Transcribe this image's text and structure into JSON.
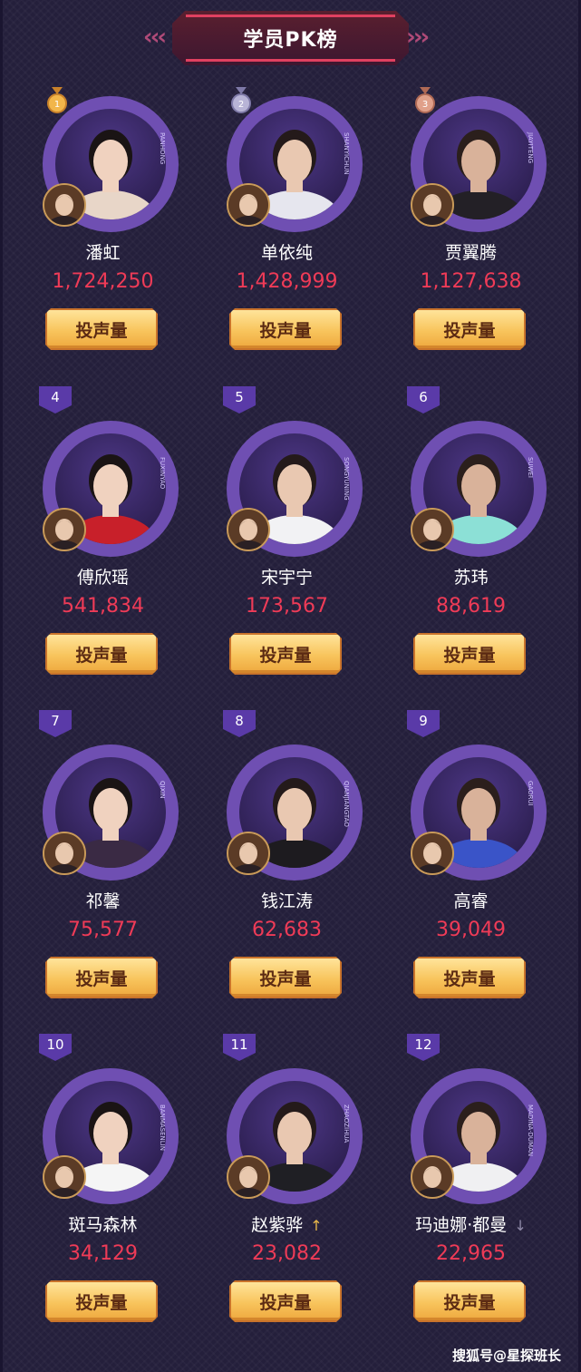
{
  "header": {
    "title": "学员PK榜",
    "left_decor": "‹‹‹",
    "right_decor": "›››"
  },
  "vote_button_label": "投声量",
  "students": [
    {
      "rank": "1",
      "name": "潘虹",
      "votes": "1,724,250",
      "ring_text": "PANHONG",
      "medal": "gold"
    },
    {
      "rank": "2",
      "name": "单依纯",
      "votes": "1,428,999",
      "ring_text": "SHANYICHUN",
      "medal": "silver"
    },
    {
      "rank": "3",
      "name": "贾翼腾",
      "votes": "1,127,638",
      "ring_text": "JIAYITENG",
      "medal": "bronze"
    },
    {
      "rank": "4",
      "name": "傅欣瑶",
      "votes": "541,834",
      "ring_text": "FUXINYAO"
    },
    {
      "rank": "5",
      "name": "宋宇宁",
      "votes": "173,567",
      "ring_text": "SONGYUNING"
    },
    {
      "rank": "6",
      "name": "苏玮",
      "votes": "88,619",
      "ring_text": "SUWEI"
    },
    {
      "rank": "7",
      "name": "祁馨",
      "votes": "75,577",
      "ring_text": "QIXIN"
    },
    {
      "rank": "8",
      "name": "钱江涛",
      "votes": "62,683",
      "ring_text": "QIANJIANGTAO"
    },
    {
      "rank": "9",
      "name": "高睿",
      "votes": "39,049",
      "ring_text": "GAORUI"
    },
    {
      "rank": "10",
      "name": "斑马森林",
      "votes": "34,129",
      "ring_text": "BANMASENLIN"
    },
    {
      "rank": "11",
      "name": "赵紫骅",
      "votes": "23,082",
      "ring_text": "ZHAOZIHUA",
      "trend": "↑"
    },
    {
      "rank": "12",
      "name": "玛迪娜·都曼",
      "votes": "22,965",
      "ring_text": "MADINA·DUMAN",
      "trend": "↓"
    }
  ],
  "colors": {
    "background": "#241f3b",
    "ring": "#6f4fb2",
    "votes": "#ef3b57",
    "button": "#f8c45c",
    "header": "#5a1f2f"
  },
  "watermark": "搜狐号@星探班长"
}
